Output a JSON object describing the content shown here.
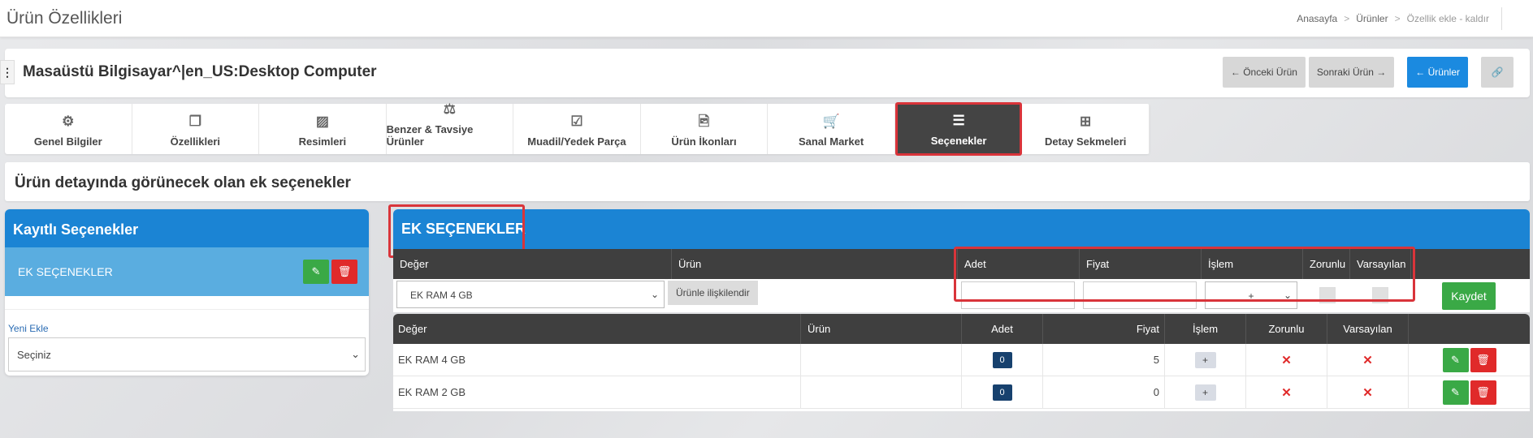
{
  "header": {
    "page_title": "Ürün Özellikleri",
    "breadcrumb": [
      "Anasayfa",
      "Ürünler",
      "Özellik ekle - kaldır"
    ]
  },
  "product": {
    "name": "Masaüstü Bilgisayar^|en_US:Desktop Computer",
    "actions": {
      "prev": "Önceki Ürün",
      "next": "Sonraki Ürün",
      "products": "Ürünler"
    }
  },
  "tabs": [
    {
      "label": "Genel Bilgiler",
      "icon": "gears-icon"
    },
    {
      "label": "Özellikleri",
      "icon": "copy-icon"
    },
    {
      "label": "Resimleri",
      "icon": "images-icon"
    },
    {
      "label": "Benzer & Tavsiye Ürünler",
      "icon": "balance-scale-icon"
    },
    {
      "label": "Muadil/Yedek Parça",
      "icon": "check-square-icon"
    },
    {
      "label": "Ürün İkonları",
      "icon": "file-image-icon"
    },
    {
      "label": "Sanal Market",
      "icon": "cart-icon"
    },
    {
      "label": "Seçenekler",
      "icon": "list-icon",
      "active": true
    },
    {
      "label": "Detay Sekmeleri",
      "icon": "sitemap-icon"
    }
  ],
  "section_title": "Ürün detayında görünecek olan ek seçenekler",
  "saved_options": {
    "title": "Kayıtlı Seçenekler",
    "item": "EK SEÇENEKLER",
    "new_label": "Yeni Ekle",
    "select_value": "Seçiniz"
  },
  "extra_options": {
    "title": "EK SEÇENEKLER",
    "form_headers": [
      "Değer",
      "Ürün",
      "Adet",
      "Fiyat",
      "İşlem",
      "Zorunlu",
      "Varsayılan"
    ],
    "form": {
      "value_select": "EK RAM 4 GB",
      "relate_button": "Ürünle ilişkilendir",
      "adet": "",
      "fiyat": "",
      "islem_select": "+",
      "save_button": "Kaydet"
    },
    "list_headers": [
      "Değer",
      "Ürün",
      "Adet",
      "Fiyat",
      "İşlem",
      "Zorunlu",
      "Varsayılan"
    ],
    "rows": [
      {
        "deger": "EK RAM 4 GB",
        "urun": "",
        "adet": "0",
        "fiyat": "5",
        "islem": "+",
        "zorunlu": "✕",
        "varsayilan": "✕"
      },
      {
        "deger": "EK RAM 2 GB",
        "urun": "",
        "adet": "0",
        "fiyat": "0",
        "islem": "+",
        "zorunlu": "✕",
        "varsayilan": "✕"
      }
    ]
  },
  "colors": {
    "accent_blue": "#1b84d4",
    "highlight_red": "#d9343a",
    "save_green": "#3aa946",
    "delete_red": "#e02a2a",
    "dark_header": "#3f3f3f"
  }
}
